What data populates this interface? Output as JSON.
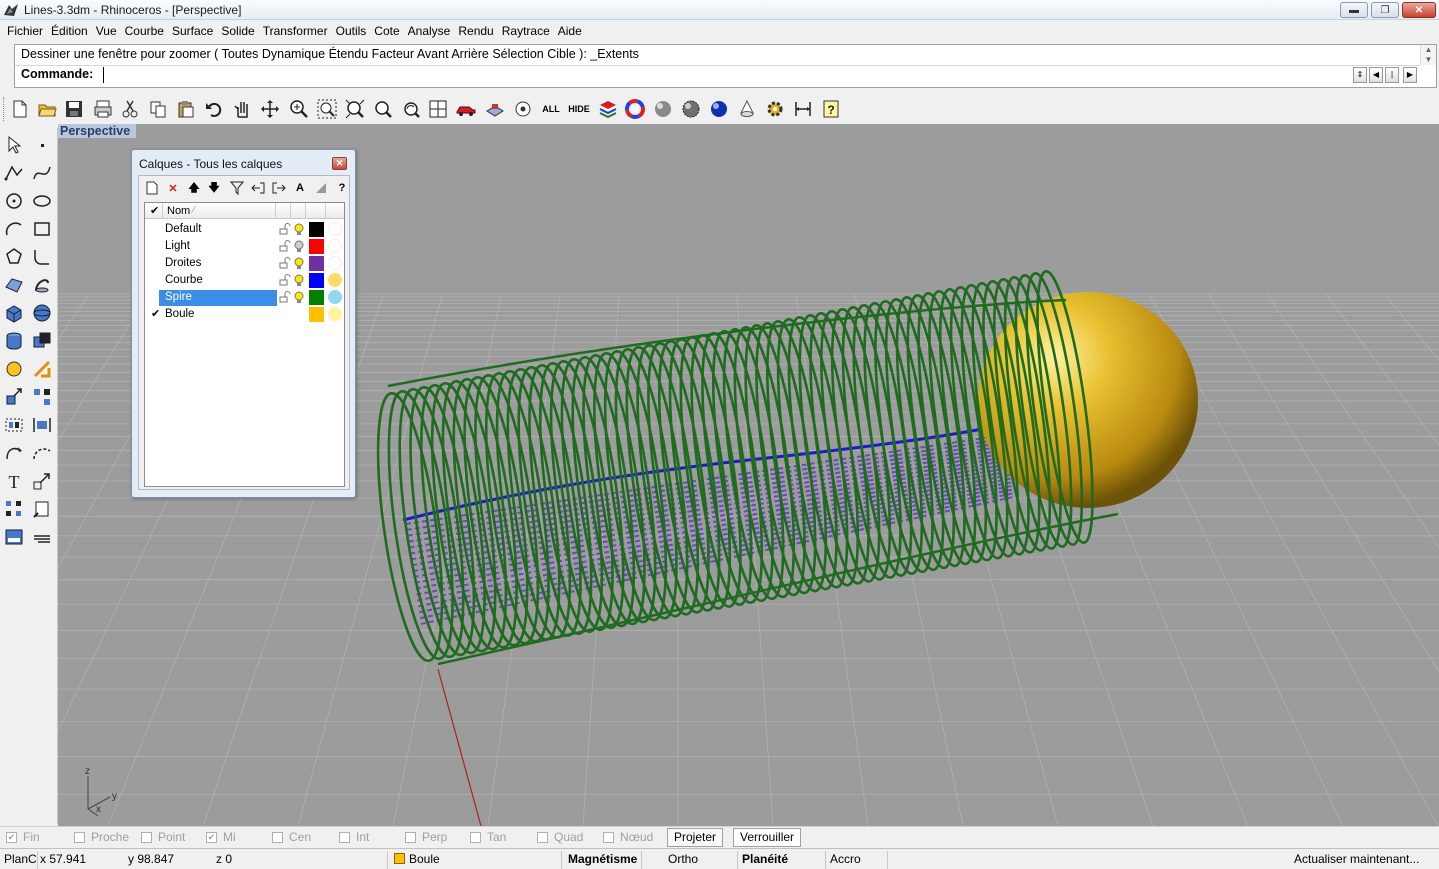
{
  "window": {
    "title": "Lines-3.3dm - Rhinoceros - [Perspective]",
    "app_icon": "rhino-icon",
    "controls": {
      "minimize": "▬",
      "maximize": "❐",
      "close": "✕"
    }
  },
  "menubar": {
    "items": [
      "Fichier",
      "Édition",
      "Vue",
      "Courbe",
      "Surface",
      "Solide",
      "Transformer",
      "Outils",
      "Cote",
      "Analyse",
      "Rendu",
      "Raytrace",
      "Aide"
    ]
  },
  "command": {
    "history": "Dessiner une fenêtre pour zoomer ( Toutes  Dynamique  Étendu  Facteur  Avant  Arrière  Sélection  Cible ): _Extents",
    "prompt_label": "Commande:",
    "input_value": ""
  },
  "toolbar": {
    "icons": [
      "new-file-icon",
      "open-folder-icon",
      "save-icon",
      "print-icon",
      "cut-icon",
      "copy-icon",
      "paste-icon",
      "undo-icon",
      "pan-hand-icon",
      "rotate-view-icon",
      "zoom-dynamic-icon",
      "zoom-window-icon",
      "zoom-extents-icon",
      "zoom-selected-icon",
      "undo-view-icon",
      "four-viewports-icon",
      "car-icon",
      "grid-object-icon",
      "show-object-icon",
      "show-all-icon",
      "hide-icon",
      "layer-stack-icon",
      "color-wheel-icon",
      "gray-sphere-icon",
      "render-sphere-icon",
      "blue-sphere-icon",
      "light-cone-icon",
      "gear-options-icon",
      "dimension-icon",
      "help-icon"
    ],
    "show_all_label": "ALL",
    "hide_label": "HIDE"
  },
  "side_toolbar": {
    "icons": [
      "select-arrow-icon",
      "point-icon",
      "polyline-icon",
      "curve-icon",
      "circle-icon",
      "ellipse-icon",
      "arc-icon",
      "rectangle-icon",
      "polygon-icon",
      "fillet-icon",
      "surface-icon",
      "revolve-icon",
      "box-icon",
      "sphere-icon",
      "cylinder-icon",
      "boolean-icon",
      "mesh-icon",
      "extrude-icon",
      "transform-icon",
      "array-icon",
      "group-icon",
      "align-icon",
      "curve-edit-icon",
      "curve-tools-icon",
      "text-icon",
      "scale-icon",
      "points-grid-icon",
      "dimension-side-icon",
      "layout-icon",
      "hatch-icon"
    ]
  },
  "viewport": {
    "tab_label": "Perspective",
    "axis_labels": {
      "z": "z",
      "y": "y",
      "x": "x"
    },
    "colors": {
      "background": "#9c9c9c",
      "grid": "#b4b4b4",
      "spring": "#1f6b1f",
      "lines": "#6a3cc8",
      "curve": "#1a1ad0",
      "ball": "#d8a81a",
      "x_axis": "#b02020"
    }
  },
  "layer_panel": {
    "title": "Calques - Tous les calques",
    "close": "✕",
    "tools": [
      "new-layer-icon",
      "delete-layer-icon",
      "move-up-icon",
      "move-down-icon",
      "filter-icon",
      "import-icon",
      "export-icon",
      "text-A-icon",
      "triangle-icon",
      "help-icon"
    ],
    "header_check": "✔",
    "header_name": "Nom",
    "layers": [
      {
        "name": "Default",
        "check": "",
        "color": "#000000",
        "bulb_on": true,
        "material": "#ffffff",
        "selected": false
      },
      {
        "name": "Light",
        "check": "",
        "color": "#ff0000",
        "bulb_on": false,
        "material": "#ffffff",
        "selected": false
      },
      {
        "name": "Droites",
        "check": "",
        "color": "#7030a0",
        "bulb_on": true,
        "material": "#ffffff",
        "selected": false
      },
      {
        "name": "Courbe",
        "check": "",
        "color": "#0000ff",
        "bulb_on": true,
        "material": "#ffd966",
        "selected": false
      },
      {
        "name": "Spire",
        "check": "",
        "color": "#008000",
        "bulb_on": true,
        "material": "#8fd8f0",
        "selected": true
      },
      {
        "name": "Boule",
        "check": "✔",
        "color": "#ffc000",
        "bulb_on": null,
        "material": "#fff2a0",
        "selected": false
      }
    ]
  },
  "osnap": {
    "items": [
      {
        "label": "Fin",
        "checked": true
      },
      {
        "label": "Proche",
        "checked": false
      },
      {
        "label": "Point",
        "checked": false
      },
      {
        "label": "Mi",
        "checked": true
      },
      {
        "label": "Cen",
        "checked": false
      },
      {
        "label": "Int",
        "checked": false
      },
      {
        "label": "Perp",
        "checked": false
      },
      {
        "label": "Tan",
        "checked": false
      },
      {
        "label": "Quad",
        "checked": false
      },
      {
        "label": "Nœud",
        "checked": false
      }
    ],
    "project_label": "Projeter",
    "lock_label": "Verrouiller"
  },
  "status": {
    "cplane": "PlanC",
    "x": "x 57.941",
    "y": "y 98.847",
    "z": "z 0",
    "layer": "Boule",
    "snap": "Magnétisme",
    "ortho": "Ortho",
    "planar": "Planéité",
    "osnap": "Accro",
    "message": "Actualiser maintenant..."
  }
}
